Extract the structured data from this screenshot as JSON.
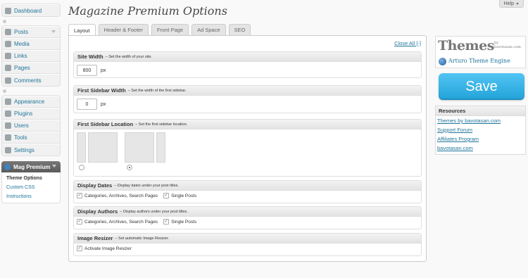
{
  "help": {
    "label": "Help"
  },
  "sidebar": {
    "group1": [
      {
        "label": "Dashboard",
        "icon": "dashboard-icon"
      }
    ],
    "group2": [
      {
        "label": "Posts",
        "icon": "pin-icon"
      },
      {
        "label": "Media",
        "icon": "media-icon"
      },
      {
        "label": "Links",
        "icon": "link-icon"
      },
      {
        "label": "Pages",
        "icon": "page-icon"
      },
      {
        "label": "Comments",
        "icon": "comment-icon"
      }
    ],
    "group3": [
      {
        "label": "Appearance",
        "icon": "appearance-icon"
      },
      {
        "label": "Plugins",
        "icon": "plugin-icon"
      },
      {
        "label": "Users",
        "icon": "users-icon"
      },
      {
        "label": "Tools",
        "icon": "tools-icon"
      },
      {
        "label": "Settings",
        "icon": "settings-icon"
      }
    ],
    "mag_premium": {
      "label": "Mag Premium",
      "items": [
        "Theme Options",
        "Custom CSS",
        "Instructions"
      ]
    }
  },
  "page": {
    "title": "Magazine Premium Options",
    "tabs": [
      "Layout",
      "Header & Footer",
      "Front Page",
      "Ad Space",
      "SEO"
    ],
    "close_all": "Close All [-]"
  },
  "options": {
    "site_width": {
      "title": "Site Width",
      "desc": "– Set the width of your site.",
      "value": "800",
      "unit": "px"
    },
    "first_sidebar_width": {
      "title": "First Sidebar Width",
      "desc": "– Set the width of the first sidebar.",
      "value": "0",
      "unit": "px"
    },
    "first_sidebar_location": {
      "title": "First Sidebar Location",
      "desc": "– Set the first sidebar location.",
      "selected": "right"
    },
    "display_dates": {
      "title": "Display Dates",
      "desc": "– Display dates under your post titles.",
      "opt1": "Categories, Archives, Search Pages",
      "opt2": "Single Posts"
    },
    "display_authors": {
      "title": "Display Authors",
      "desc": "– Display authors under your post titles.",
      "opt1": "Categories, Archives, Search Pages",
      "opt2": "Single Posts"
    },
    "image_resizer": {
      "title": "Image Resizer",
      "desc": "– Set automatic Image Resizer.",
      "opt1": "Activate Image Resizer"
    }
  },
  "logo": {
    "main": "Themes",
    "by_line1": "by",
    "by_line2": "bavotasan.com",
    "engine": "Arturo Theme Engine"
  },
  "save": {
    "label": "Save",
    "color": "#2fb0e6"
  },
  "resources": {
    "title": "Resources",
    "links": [
      "Themes by bavotasan.com",
      "Support Forum",
      "Affiliates Program",
      "bavotasan.com"
    ]
  },
  "colors": {
    "link": "#21759b",
    "background": "#f9f9f9"
  }
}
